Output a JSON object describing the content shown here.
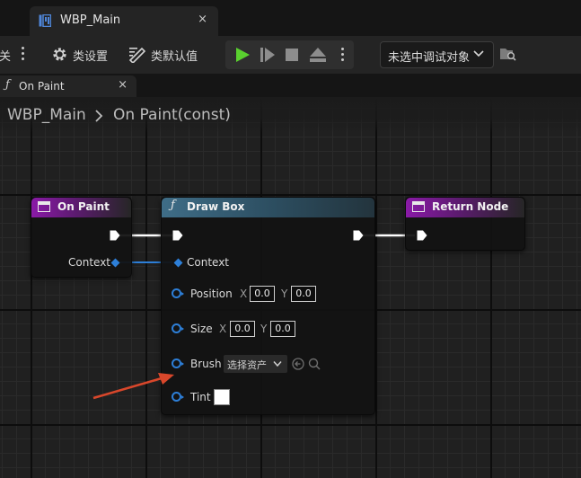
{
  "window": {
    "tab_title": "WBP_Main",
    "tab_close": "×"
  },
  "toolbar": {
    "cut_label": "关",
    "class_settings_label": "类设置",
    "class_defaults_label": "类默认值",
    "debug_target_label": "未选中调试对象",
    "icons": [
      "gear-icon",
      "class-defaults-icon",
      "play-icon",
      "step-icon",
      "stop-icon",
      "eject-icon",
      "folder-search-icon"
    ],
    "play_color": "#5ad12f"
  },
  "graph_tab": {
    "glyph": "ƒ",
    "label": "On Paint",
    "close": "×"
  },
  "breadcrumb": {
    "root": "WBP_Main",
    "current": "On Paint(const)"
  },
  "nodes": {
    "on_paint": {
      "title": "On Paint",
      "context_label": "Context",
      "header_color": "#8a1aa7"
    },
    "draw_box": {
      "glyph": "ƒ",
      "title": "Draw Box",
      "context_label": "Context",
      "position": {
        "label": "Position",
        "x_label": "X",
        "x_value": "0.0",
        "y_label": "Y",
        "y_value": "0.0"
      },
      "size": {
        "label": "Size",
        "x_label": "X",
        "x_value": "0.0",
        "y_label": "Y",
        "y_value": "0.0"
      },
      "brush": {
        "label": "Brush",
        "asset_placeholder": "选择资产"
      },
      "tint": {
        "label": "Tint",
        "swatch_color": "#ffffff"
      },
      "header_color": "#3f6d87"
    },
    "return_node": {
      "title": "Return Node",
      "header_color": "#8a1aa7"
    }
  },
  "colors": {
    "pin_blue": "#2d7fd8",
    "annotation_arrow": "#d9472b"
  }
}
